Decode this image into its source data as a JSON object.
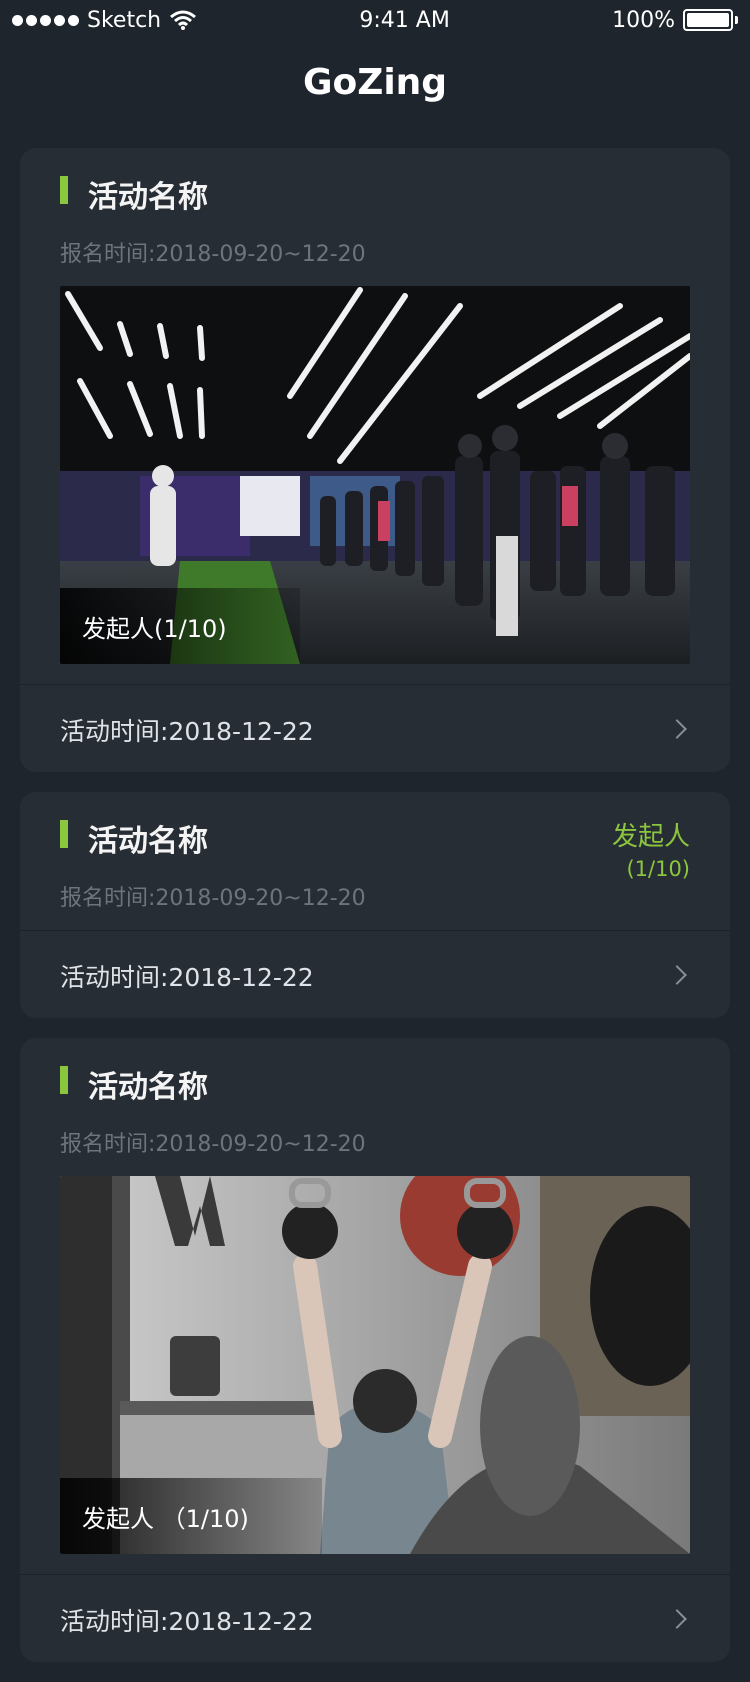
{
  "status_bar": {
    "carrier": "Sketch",
    "time": "9:41 AM",
    "battery": "100%"
  },
  "app_title": "GoZing",
  "cards": [
    {
      "title": "活动名称",
      "signup_time": "报名时间:2018-09-20~12-20",
      "organizer_overlay": "发起人(1/10)",
      "activity_time": "活动时间:2018-12-22"
    },
    {
      "title": "活动名称",
      "signup_time": "报名时间:2018-09-20~12-20",
      "organizer_label": "发起人",
      "organizer_count": "(1/10)",
      "activity_time": "活动时间:2018-12-22"
    },
    {
      "title": "活动名称",
      "signup_time": "报名时间:2018-09-20~12-20",
      "organizer_overlay": "发起人 （1/10)",
      "activity_time": "活动时间:2018-12-22"
    }
  ],
  "colors": {
    "accent": "#8cc63f",
    "background": "#1f252c",
    "card": "#272d35"
  }
}
